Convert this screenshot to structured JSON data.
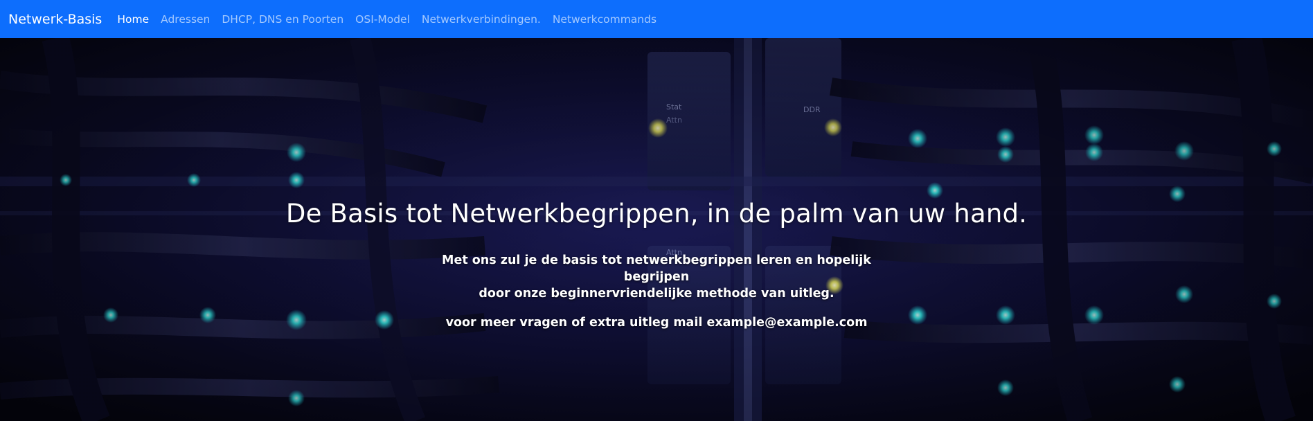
{
  "navbar": {
    "brand": "Netwerk-Basis",
    "links": [
      {
        "label": "Home",
        "active": true
      },
      {
        "label": "Adressen",
        "active": false
      },
      {
        "label": "DHCP, DNS en Poorten",
        "active": false
      },
      {
        "label": "OSI-Model",
        "active": false
      },
      {
        "label": "Netwerkverbindingen.",
        "active": false
      },
      {
        "label": "Netwerkcommands",
        "active": false
      }
    ],
    "color": "#0d6efd"
  },
  "hero": {
    "title": "De Basis tot Netwerkbegrippen, in de palm van uw hand.",
    "lead_line1": "Met ons zul je de basis tot netwerkbegrippen leren en hopelijk begrijpen",
    "lead_line2": "door onze beginnervriendelijke methode van uitleg.",
    "contact": "voor meer vragen of extra uitleg mail example@example.com",
    "background": {
      "subject": "server-rack-with-network-cables",
      "labels": [
        "Stat",
        "Attn",
        "DDR",
        "Attn"
      ],
      "tint": "#1a1a6e",
      "led_color": "#2ee6e6"
    }
  }
}
